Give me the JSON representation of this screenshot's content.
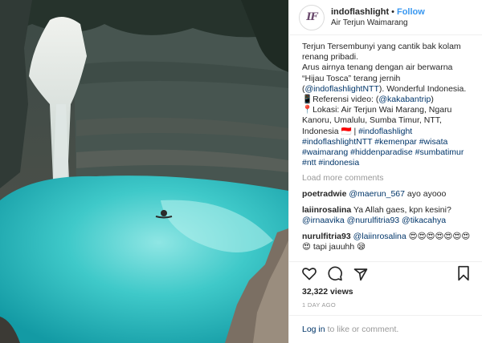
{
  "header": {
    "username": "indoflashlight",
    "separator": "•",
    "follow_label": "Follow",
    "location": "Air Terjun Waimarang",
    "avatar_text": "IF"
  },
  "caption": {
    "text": "Terjun Tersembunyi yang cantik bak kolam renang pribadi.\nArus airnya tenang dengan air berwarna “Hijau Tosca” terang jernih (",
    "mention1": "@indoflashlightNTT",
    "text2": "). Wonderful Indonesia.\n📱Referensi video: (",
    "mention2": "@kakabantrip",
    "text3": ")\n📍Lokasi: Air Terjun Wai Marang, Ngaru Kanoru, Umalulu, Sumba Timur, NTT, Indonesia 🇮🇩 | ",
    "hashtags": "#indoflashlight #indoflashlightNTT #kemenpar #wisata #waimarang #hiddenparadise #sumbatimur #ntt #indonesia"
  },
  "load_more_label": "Load more comments",
  "comments": [
    {
      "user": "poetradwie",
      "mention": "@maerun_567",
      "text": " ayo ayooo"
    },
    {
      "user": "laiinrosalina",
      "text": "Ya Allah gaes, kpn kesini? ",
      "mention": "@irnaavika @nurulfitria93 @tikacahya"
    },
    {
      "user": "nurulfitria93",
      "mention": "@laiinrosalina",
      "text": " 😍😍😍😍😍😍😍😍 tapi jauuhh 😪"
    }
  ],
  "icons": [
    "heart-icon",
    "comment-icon",
    "share-icon",
    "bookmark-icon"
  ],
  "views": "32,322 views",
  "time_ago": "1 DAY AGO",
  "login": {
    "link": "Log in",
    "text": "to like or comment."
  },
  "colors": {
    "link_blue": "#3897f0",
    "mention_navy": "#003569",
    "water": "#3fc9c9"
  }
}
